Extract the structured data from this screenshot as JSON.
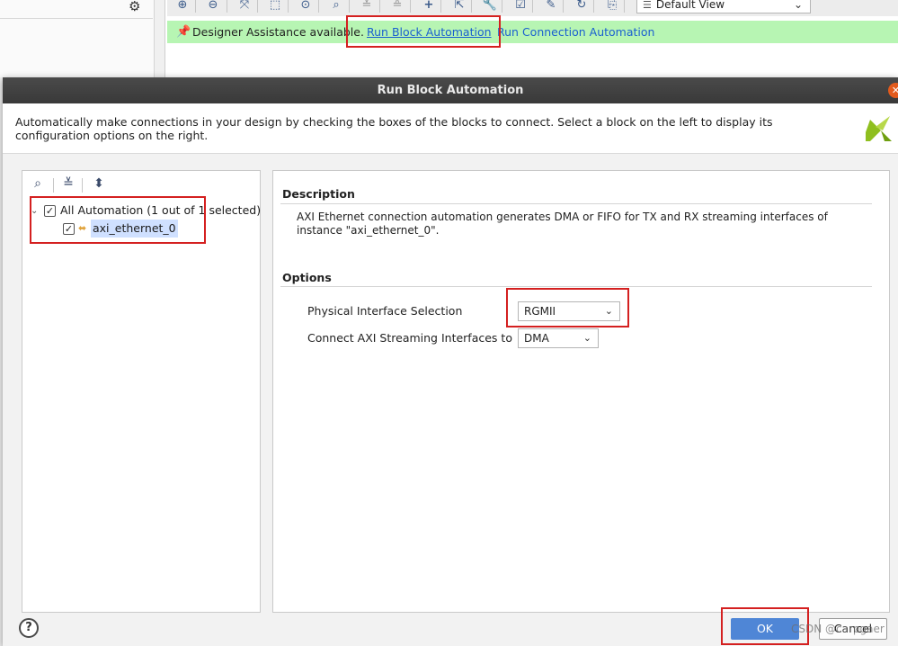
{
  "background": {
    "view_select": "Default View",
    "assist": {
      "message": "Designer Assistance available.",
      "run_block_link": "Run Block Automation",
      "run_connection_link": "Run Connection Automation"
    },
    "toolbar_icons": [
      "zoom-in",
      "zoom-out",
      "fit-view",
      "fit-selection",
      "target",
      "search",
      "collapse",
      "expand",
      "add",
      "add-module",
      "wrench",
      "validate",
      "pin",
      "refresh",
      "regenerate"
    ]
  },
  "dialog": {
    "title": "Run Block Automation",
    "header_text": "Automatically make connections in your design by checking the boxes of the blocks to connect. Select a block on the left to display its configuration options on the right.",
    "tree": {
      "root_label": "All Automation (1 out of 1 selected)",
      "root_checked": true,
      "items": [
        {
          "label": "axi_ethernet_0",
          "checked": true
        }
      ]
    },
    "description": {
      "title": "Description",
      "text": "AXI Ethernet connection automation generates DMA or FIFO for TX and RX streaming interfaces of instance \"axi_ethernet_0\"."
    },
    "options": {
      "title": "Options",
      "physical_interface": {
        "label": "Physical Interface Selection",
        "value": "RGMII"
      },
      "axi_streaming": {
        "label": "Connect AXI Streaming Interfaces to",
        "value": "DMA"
      }
    },
    "buttons": {
      "help": "?",
      "ok": "OK",
      "cancel": "Cancel"
    }
  },
  "watermark": "CSDN @carpgaer",
  "colors": {
    "assist_bar": "#b7f5b3",
    "link": "#1a5fd0",
    "highlight_box": "#d42020",
    "ok_button": "#4f86d6",
    "title_bar": "#3f3f3f"
  }
}
